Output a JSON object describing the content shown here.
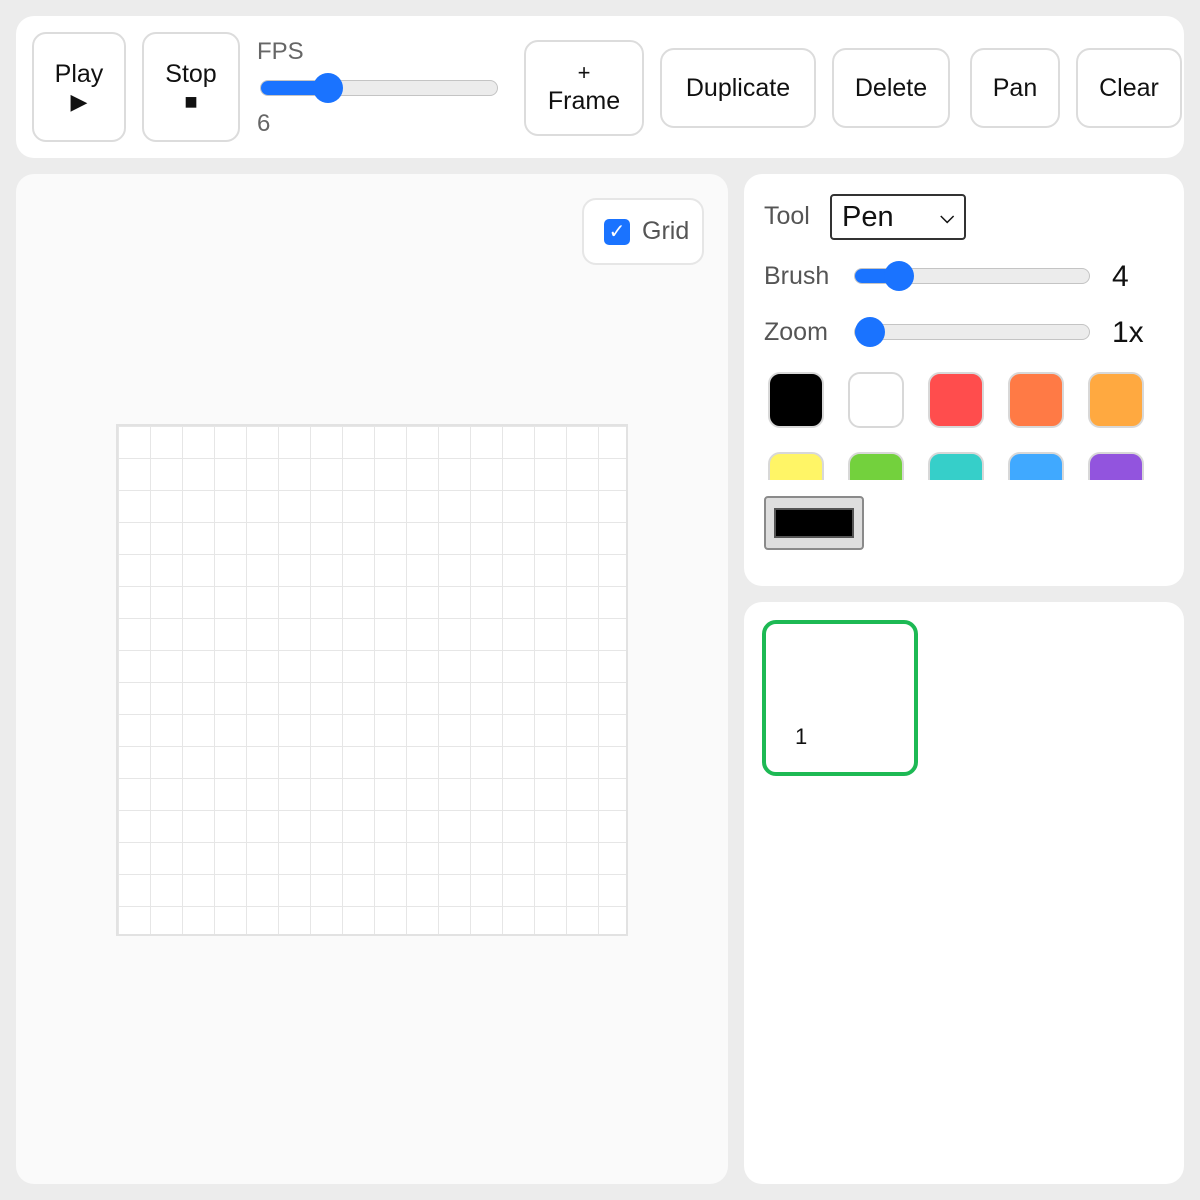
{
  "toolbar": {
    "play": {
      "label": "Play",
      "icon": "▶"
    },
    "stop": {
      "label": "Stop",
      "icon": "■"
    },
    "fps": {
      "label": "FPS",
      "value": "6",
      "level": 0.25
    },
    "add_frame": {
      "icon": "+",
      "label": "Frame"
    },
    "duplicate": "Duplicate",
    "delete": "Delete",
    "pan": "Pan",
    "clear": "Clear"
  },
  "canvas": {
    "grid_toggle": {
      "label": "Grid",
      "checked": true
    }
  },
  "tools": {
    "tool": {
      "label": "Tool",
      "selected": "Pen"
    },
    "brush": {
      "label": "Brush",
      "value": "4",
      "level": 0.14
    },
    "zoom": {
      "label": "Zoom",
      "value": "1x",
      "level": 0.0
    },
    "palette": [
      "#000000",
      "#ffffff",
      "#ff4d4d",
      "#ff7a45",
      "#ffa940",
      "#fff566",
      "#73d13d",
      "#36cfc9",
      "#40a9ff",
      "#9254de"
    ],
    "current_color": "#000000"
  },
  "frames": [
    {
      "number": "1",
      "selected": true
    }
  ],
  "colors": {
    "accent": "#1a73ff",
    "frame_selected": "#1db954"
  }
}
